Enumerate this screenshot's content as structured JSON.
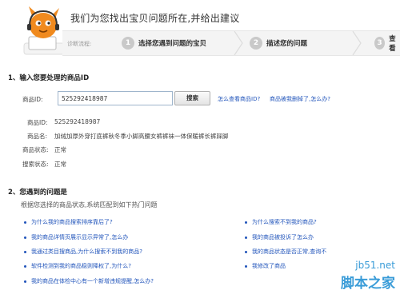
{
  "header": {
    "title": "我们为您找出宝贝问题所在,并给出建议",
    "step_label": "诊断流程:",
    "steps": [
      {
        "num": "1",
        "label": "选择您遇到问题的宝贝"
      },
      {
        "num": "2",
        "label": "描述您的问题"
      },
      {
        "num": "3",
        "label": "查看"
      }
    ]
  },
  "section1": {
    "title": "1、输入您要处理的商品ID",
    "id_label": "商品ID:",
    "id_value": "525292418987",
    "search_button": "搜索",
    "link_howto": "怎么查看商品ID?",
    "link_deleted": "商品被我删掉了,怎么办?",
    "details": [
      {
        "label": "商品ID:",
        "value": "525292418987"
      },
      {
        "label": "商品名:",
        "value": "加绒加厚外穿打底裤秋冬季小脚高腰女裤裤袜一体保暖裤长裤踩脚"
      },
      {
        "label": "商品状态:",
        "value": "正常"
      },
      {
        "label": "搜索状态:",
        "value": "正常"
      }
    ]
  },
  "section2": {
    "title": "2、您遇到的问题是",
    "hint": "根据您选择的商品状态,系统匹配到如下热门问题",
    "left_questions": [
      "为什么我的商品搜索排序靠后了?",
      "我的商品详情页展示显示异常了,怎么办",
      "我通过类目搜商品,为什么搜索不到我的商品?",
      "软件检测到我的商品稳则降权了,为什么?",
      "我的商品在体检中心有一个新增违规提醒,怎么办?"
    ],
    "right_questions": [
      "为什么搜索不到我的商品?",
      "我的商品被投诉了怎么办",
      "我的商品状态是否正常,查询不",
      "我修改了商品"
    ]
  },
  "watermark": {
    "top": "jb51.net",
    "bottom": "脚本之家"
  },
  "colors": {
    "link": "#2255bb",
    "mascot": "#f08a1e",
    "watermark": "#3a9cd8"
  }
}
